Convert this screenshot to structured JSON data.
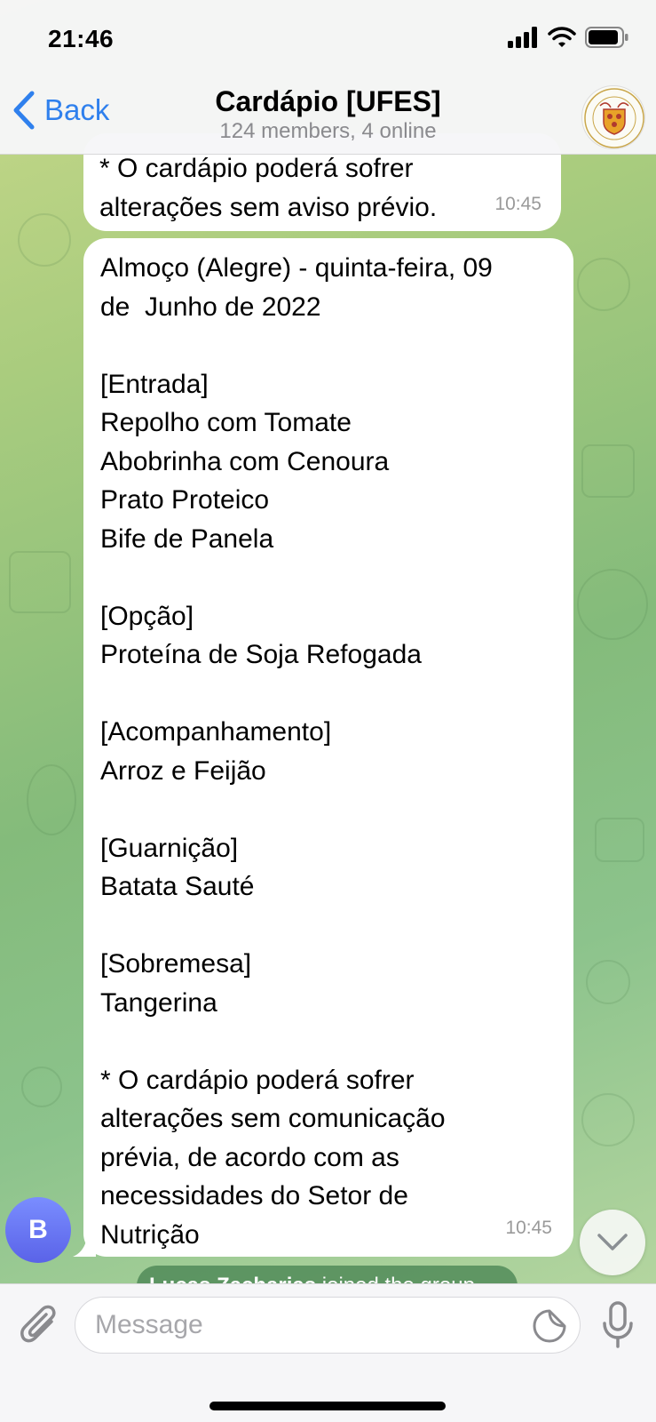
{
  "status_bar": {
    "time": "21:46"
  },
  "header": {
    "back_label": "Back",
    "title": "Cardápio [UFES]",
    "subtitle": "124 members, 4 online"
  },
  "messages": [
    {
      "text": "* O cardápio poderá sofrer\nalterações sem aviso prévio.",
      "time": "10:45"
    },
    {
      "text": "Almoço (Alegre) - quinta-feira, 09\nde  Junho de 2022\n\n[Entrada]\nRepolho com Tomate\nAbobrinha com Cenoura\nPrato Proteico\nBife de Panela\n\n[Opção]\nProteína de Soja Refogada\n\n[Acompanhamento]\nArroz e Feijão\n\n[Guarnição]\nBatata Sauté\n\n[Sobremesa]\nTangerina\n\n* O cardápio poderá sofrer\nalterações sem comunicação\nprévia, de acordo com as\nnecessidades do Setor de\nNutrição",
      "time": "10:45"
    }
  ],
  "sender_avatar_initial": "B",
  "service_message": {
    "name": "Lucas Zacharias",
    "action": "joined the group"
  },
  "input": {
    "placeholder": "Message",
    "value": ""
  },
  "icons": {
    "back": "chevron-left-icon",
    "attach": "paperclip-icon",
    "sticker": "sticker-icon",
    "mic": "microphone-icon",
    "scroll_down": "chevron-down-icon",
    "signal": "cellular-signal-icon",
    "wifi": "wifi-icon",
    "battery": "battery-icon"
  },
  "colors": {
    "accent": "#2f80ed",
    "avatar": "#6673f0",
    "wallpaper_start": "#c9d98a",
    "wallpaper_end": "#84bb7b"
  }
}
